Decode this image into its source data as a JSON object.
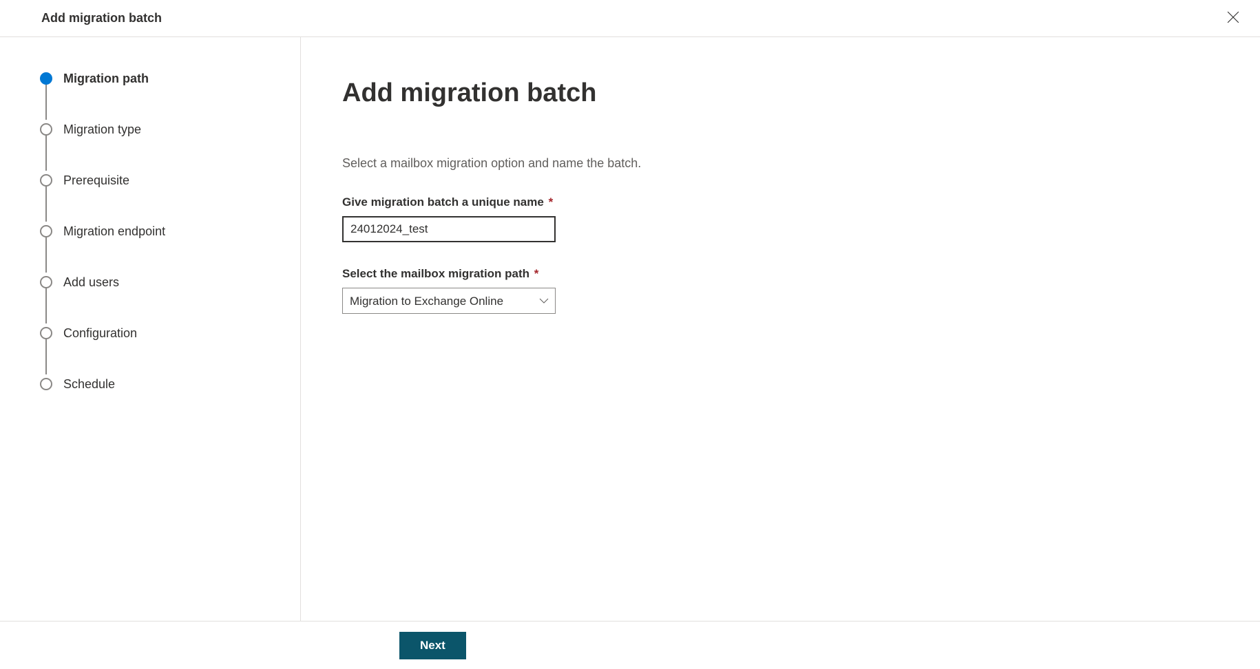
{
  "header": {
    "title": "Add migration batch"
  },
  "sidebar": {
    "steps": [
      {
        "label": "Migration path",
        "active": true
      },
      {
        "label": "Migration type",
        "active": false
      },
      {
        "label": "Prerequisite",
        "active": false
      },
      {
        "label": "Migration endpoint",
        "active": false
      },
      {
        "label": "Add users",
        "active": false
      },
      {
        "label": "Configuration",
        "active": false
      },
      {
        "label": "Schedule",
        "active": false
      }
    ]
  },
  "main": {
    "title": "Add migration batch",
    "description": "Select a mailbox migration option and name the batch.",
    "fields": {
      "name_label": "Give migration batch a unique name",
      "name_value": "24012024_test",
      "path_label": "Select the mailbox migration path",
      "path_value": "Migration to Exchange Online"
    }
  },
  "footer": {
    "next_label": "Next"
  }
}
